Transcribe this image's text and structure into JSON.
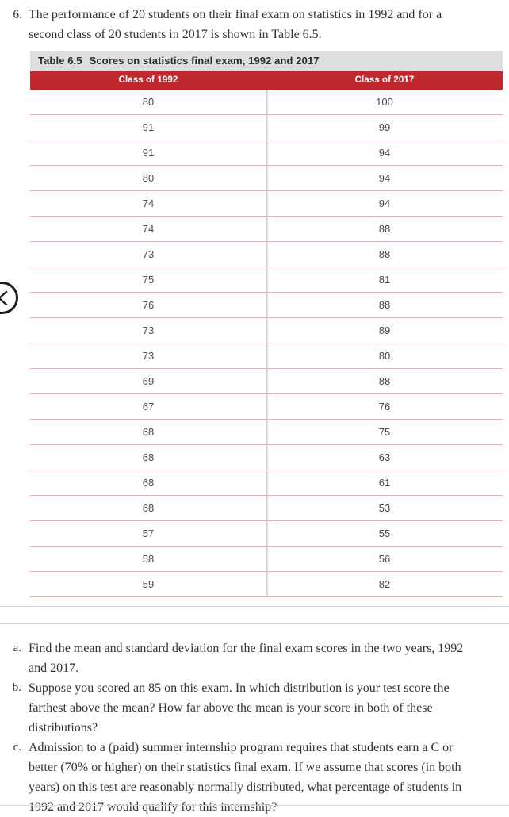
{
  "question": {
    "marker": "6.",
    "text": "The performance of 20 students on their final exam on statistics in 1992 and for a second class of 20 students in 2017 is shown in Table 6.5."
  },
  "table": {
    "caption_label": "Table 6.5",
    "caption_title": "Scores on statistics final exam, 1992 and 2017",
    "header_fill": "#c0282d",
    "caption_fill": "#dedede",
    "row_rule_color": "#dcb5b5",
    "columns": [
      "Class of 1992",
      "Class of 2017"
    ],
    "rows": [
      [
        "80",
        "100"
      ],
      [
        "91",
        "99"
      ],
      [
        "91",
        "94"
      ],
      [
        "80",
        "94"
      ],
      [
        "74",
        "94"
      ],
      [
        "74",
        "88"
      ],
      [
        "73",
        "88"
      ],
      [
        "75",
        "81"
      ],
      [
        "76",
        "88"
      ],
      [
        "73",
        "89"
      ],
      [
        "73",
        "80"
      ],
      [
        "69",
        "88"
      ],
      [
        "67",
        "76"
      ],
      [
        "68",
        "75"
      ],
      [
        "68",
        "63"
      ],
      [
        "68",
        "61"
      ],
      [
        "68",
        "53"
      ],
      [
        "57",
        "55"
      ],
      [
        "58",
        "56"
      ],
      [
        "59",
        "82"
      ]
    ]
  },
  "subquestions": [
    {
      "marker": "a.",
      "text": "Find the mean and standard deviation for the final exam scores in the two years, 1992 and 2017."
    },
    {
      "marker": "b.",
      "text": "Suppose you scored an 85 on this exam. In which distribution is your test score the farthest above the mean? How far above the mean is your score in both of these distributions?"
    },
    {
      "marker": "c.",
      "text": "Admission to a (paid) summer internship program requires that students earn a C or better (70% or higher) on their statistics final exam. If we assume that scores (in both years) on this test are reasonably normally distributed, what percentage of students in 1992 and 2017 would qualify for this internship?"
    }
  ],
  "navigation": {
    "previous_page_icon": "chevron-left-icon"
  }
}
